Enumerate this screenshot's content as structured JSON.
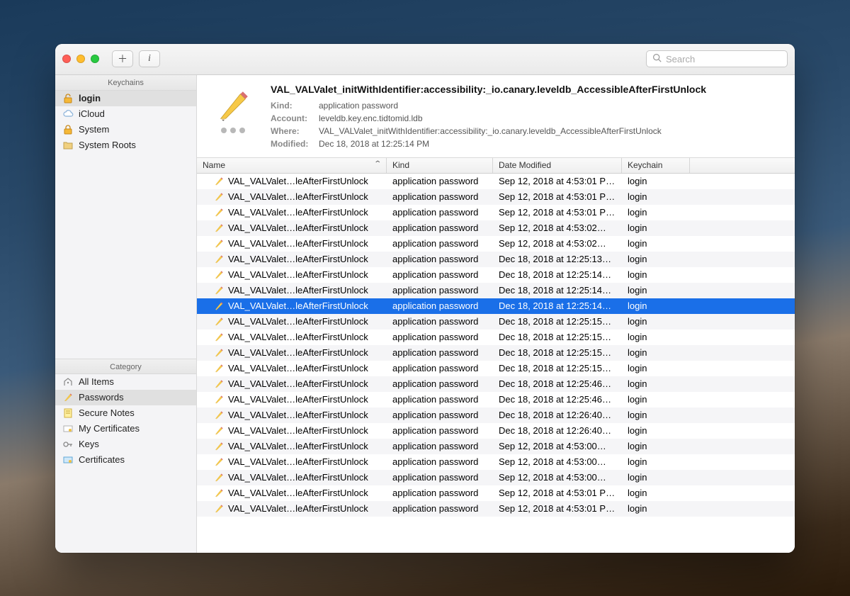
{
  "toolbar": {
    "search_placeholder": "Search"
  },
  "sidebar": {
    "keychains_header": "Keychains",
    "category_header": "Category",
    "keychains": [
      {
        "label": "login",
        "icon": "lock-open-icon",
        "selected": true
      },
      {
        "label": "iCloud",
        "icon": "cloud-icon"
      },
      {
        "label": "System",
        "icon": "lock-icon"
      },
      {
        "label": "System Roots",
        "icon": "folder-icon"
      }
    ],
    "categories": [
      {
        "label": "All Items",
        "icon": "all-items-icon"
      },
      {
        "label": "Passwords",
        "icon": "password-icon",
        "selected": true
      },
      {
        "label": "Secure Notes",
        "icon": "note-icon"
      },
      {
        "label": "My Certificates",
        "icon": "my-cert-icon"
      },
      {
        "label": "Keys",
        "icon": "key-icon"
      },
      {
        "label": "Certificates",
        "icon": "cert-icon"
      }
    ]
  },
  "detail": {
    "title": "VAL_VALValet_initWithIdentifier:accessibility:_io.canary.leveldb_AccessibleAfterFirstUnlock",
    "kind_label": "Kind:",
    "kind_value": "application password",
    "account_label": "Account:",
    "account_value": "leveldb.key.enc.tidtomid.ldb",
    "where_label": "Where:",
    "where_value": "VAL_VALValet_initWithIdentifier:accessibility:_io.canary.leveldb_AccessibleAfterFirstUnlock",
    "modified_label": "Modified:",
    "modified_value": "Dec 18, 2018 at 12:25:14 PM"
  },
  "table": {
    "columns": {
      "name": "Name",
      "kind": "Kind",
      "date": "Date Modified",
      "keychain": "Keychain"
    },
    "rows": [
      {
        "name": "VAL_VALValet…leAfterFirstUnlock",
        "kind": "application password",
        "date": "Sep 12, 2018 at 4:53:01 P…",
        "keychain": "login"
      },
      {
        "name": "VAL_VALValet…leAfterFirstUnlock",
        "kind": "application password",
        "date": "Sep 12, 2018 at 4:53:01 P…",
        "keychain": "login"
      },
      {
        "name": "VAL_VALValet…leAfterFirstUnlock",
        "kind": "application password",
        "date": "Sep 12, 2018 at 4:53:01 P…",
        "keychain": "login"
      },
      {
        "name": "VAL_VALValet…leAfterFirstUnlock",
        "kind": "application password",
        "date": "Sep 12, 2018 at 4:53:02…",
        "keychain": "login"
      },
      {
        "name": "VAL_VALValet…leAfterFirstUnlock",
        "kind": "application password",
        "date": "Sep 12, 2018 at 4:53:02…",
        "keychain": "login"
      },
      {
        "name": "VAL_VALValet…leAfterFirstUnlock",
        "kind": "application password",
        "date": "Dec 18, 2018 at 12:25:13…",
        "keychain": "login"
      },
      {
        "name": "VAL_VALValet…leAfterFirstUnlock",
        "kind": "application password",
        "date": "Dec 18, 2018 at 12:25:14…",
        "keychain": "login"
      },
      {
        "name": "VAL_VALValet…leAfterFirstUnlock",
        "kind": "application password",
        "date": "Dec 18, 2018 at 12:25:14…",
        "keychain": "login"
      },
      {
        "name": "VAL_VALValet…leAfterFirstUnlock",
        "kind": "application password",
        "date": "Dec 18, 2018 at 12:25:14…",
        "keychain": "login",
        "selected": true
      },
      {
        "name": "VAL_VALValet…leAfterFirstUnlock",
        "kind": "application password",
        "date": "Dec 18, 2018 at 12:25:15…",
        "keychain": "login"
      },
      {
        "name": "VAL_VALValet…leAfterFirstUnlock",
        "kind": "application password",
        "date": "Dec 18, 2018 at 12:25:15…",
        "keychain": "login"
      },
      {
        "name": "VAL_VALValet…leAfterFirstUnlock",
        "kind": "application password",
        "date": "Dec 18, 2018 at 12:25:15…",
        "keychain": "login"
      },
      {
        "name": "VAL_VALValet…leAfterFirstUnlock",
        "kind": "application password",
        "date": "Dec 18, 2018 at 12:25:15…",
        "keychain": "login"
      },
      {
        "name": "VAL_VALValet…leAfterFirstUnlock",
        "kind": "application password",
        "date": "Dec 18, 2018 at 12:25:46…",
        "keychain": "login"
      },
      {
        "name": "VAL_VALValet…leAfterFirstUnlock",
        "kind": "application password",
        "date": "Dec 18, 2018 at 12:25:46…",
        "keychain": "login"
      },
      {
        "name": "VAL_VALValet…leAfterFirstUnlock",
        "kind": "application password",
        "date": "Dec 18, 2018 at 12:26:40…",
        "keychain": "login"
      },
      {
        "name": "VAL_VALValet…leAfterFirstUnlock",
        "kind": "application password",
        "date": "Dec 18, 2018 at 12:26:40…",
        "keychain": "login"
      },
      {
        "name": "VAL_VALValet…leAfterFirstUnlock",
        "kind": "application password",
        "date": "Sep 12, 2018 at 4:53:00…",
        "keychain": "login"
      },
      {
        "name": "VAL_VALValet…leAfterFirstUnlock",
        "kind": "application password",
        "date": "Sep 12, 2018 at 4:53:00…",
        "keychain": "login"
      },
      {
        "name": "VAL_VALValet…leAfterFirstUnlock",
        "kind": "application password",
        "date": "Sep 12, 2018 at 4:53:00…",
        "keychain": "login"
      },
      {
        "name": "VAL_VALValet…leAfterFirstUnlock",
        "kind": "application password",
        "date": "Sep 12, 2018 at 4:53:01 P…",
        "keychain": "login"
      },
      {
        "name": "VAL_VALValet…leAfterFirstUnlock",
        "kind": "application password",
        "date": "Sep 12, 2018 at 4:53:01 P…",
        "keychain": "login"
      }
    ]
  }
}
